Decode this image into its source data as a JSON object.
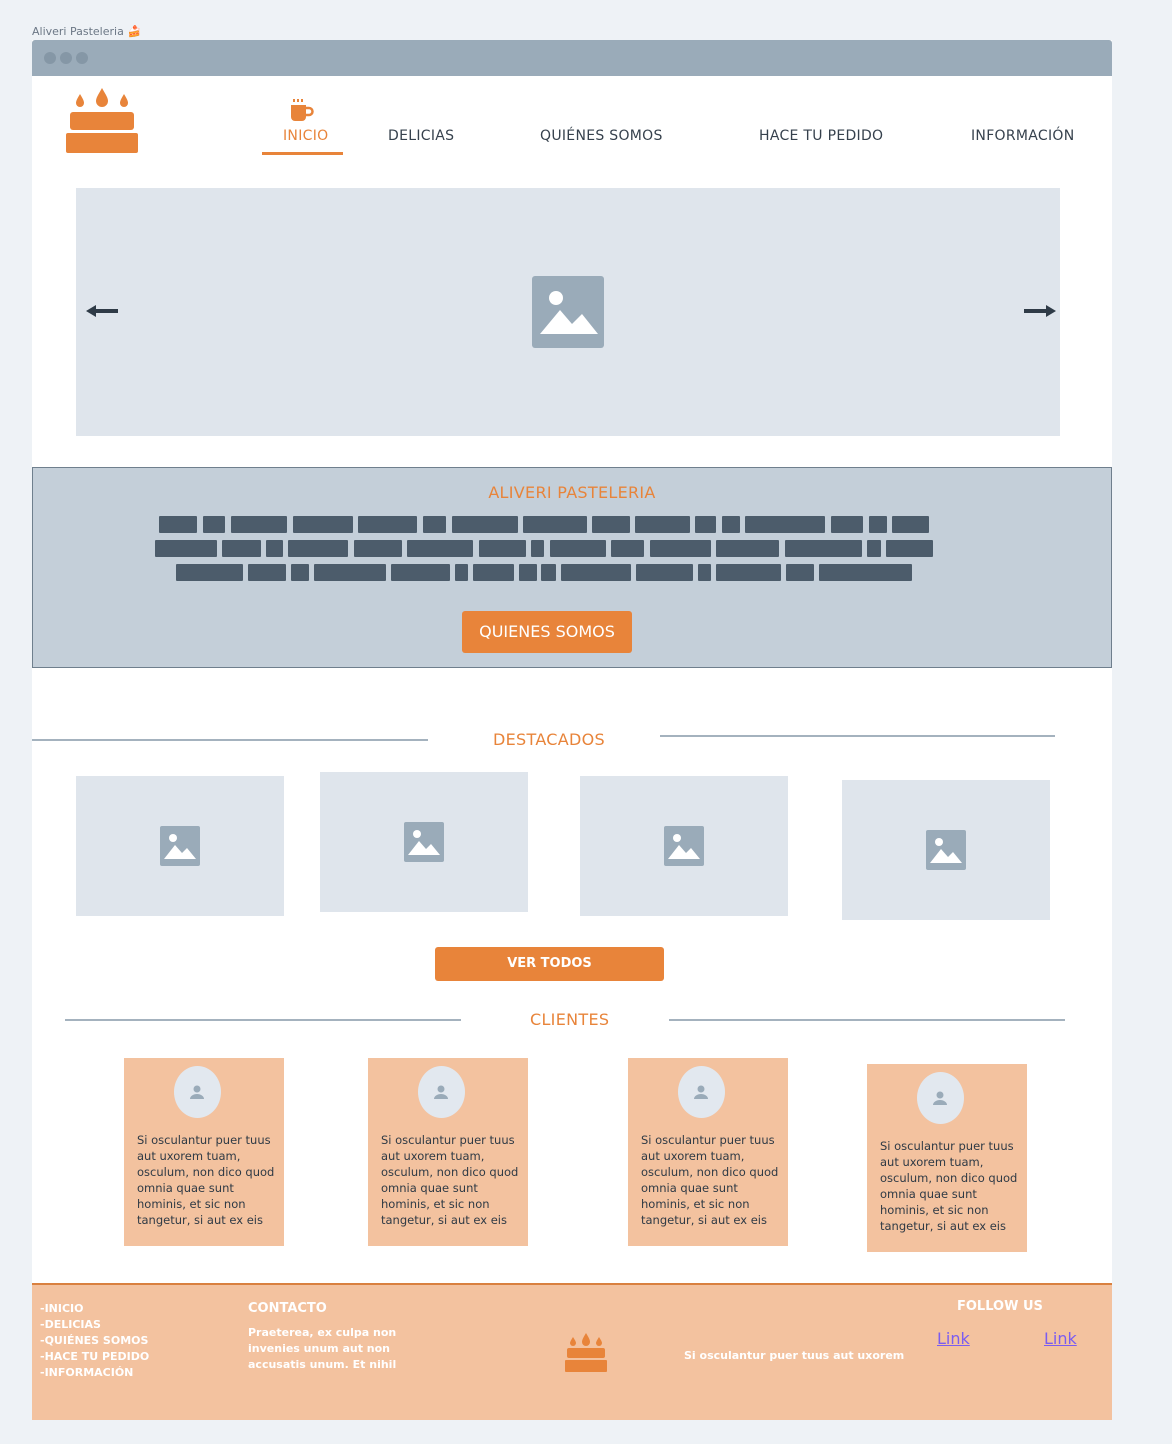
{
  "page": {
    "title": "Aliveri Pasteleria",
    "title_emoji": "🍰"
  },
  "nav": {
    "items": [
      {
        "label": "INICIO",
        "active": true
      },
      {
        "label": "DELICIAS"
      },
      {
        "label": "QUIÉNES SOMOS"
      },
      {
        "label": "HACE TU PEDIDO"
      },
      {
        "label": "INFORMACIÓN"
      }
    ]
  },
  "hero": {
    "prev_icon": "arrow-left-icon",
    "next_icon": "arrow-right-icon",
    "image_icon": "image-placeholder-icon"
  },
  "about": {
    "title": "ALIVERI PASTELERIA",
    "button_label": "QUIENES SOMOS"
  },
  "featured": {
    "title": "DESTACADOS",
    "button_label": "VER TODOS"
  },
  "clients": {
    "title": "CLIENTES",
    "testimonials": [
      {
        "text": "Si osculantur puer tuus aut uxorem tuam, osculum, non dico quod omnia quae sunt hominis, et sic non tangetur, si aut ex eis"
      },
      {
        "text": "Si osculantur puer tuus aut uxorem tuam, osculum, non dico quod omnia quae sunt hominis, et sic non tangetur, si aut ex eis"
      },
      {
        "text": "Si osculantur puer tuus aut uxorem tuam, osculum, non dico quod omnia quae sunt hominis, et sic non tangetur, si aut ex eis"
      },
      {
        "text": "Si osculantur puer tuus aut uxorem tuam, osculum, non dico quod omnia quae sunt hominis, et sic non tangetur, si aut ex eis"
      }
    ]
  },
  "footer": {
    "nav": [
      "-INICIO",
      "-DELICIAS",
      "-QUIÉNES SOMOS",
      "-HACE TU PEDIDO",
      "-INFORMACIÓN"
    ],
    "contact_title": "CONTACTO",
    "contact_text": "Praeterea, ex culpa non invenies unum aut non accusatis unum. Et nihil",
    "tagline": "Si osculantur puer tuus aut uxorem",
    "follow_title": "FOLLOW US",
    "links": [
      "Link",
      "Link"
    ]
  },
  "colors": {
    "accent": "#e8843a",
    "placeholder": "#dfe5ec",
    "band": "#c4cfd9",
    "footer": "#f3c29f",
    "titlebar": "#9aabb9"
  }
}
